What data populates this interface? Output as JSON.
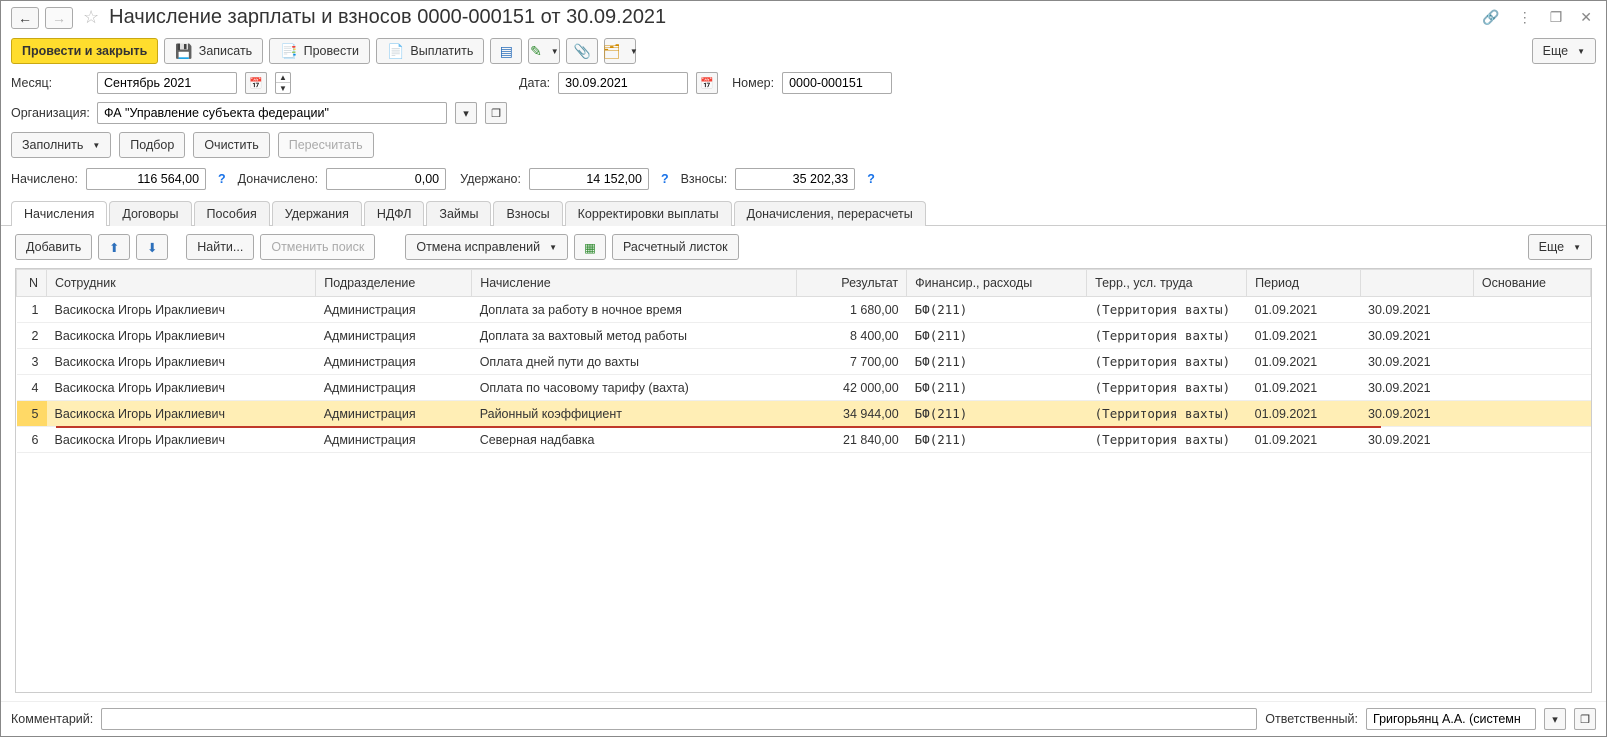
{
  "title": "Начисление зарплаты и взносов 0000-000151 от 30.09.2021",
  "toolbar": {
    "post_and_close": "Провести и закрыть",
    "save": "Записать",
    "post": "Провести",
    "pay": "Выплатить",
    "more": "Еще"
  },
  "fields": {
    "month_label": "Месяц:",
    "month_value": "Сентябрь 2021",
    "date_label": "Дата:",
    "date_value": "30.09.2021",
    "number_label": "Номер:",
    "number_value": "0000-000151",
    "org_label": "Организация:",
    "org_value": "ФА \"Управление субъекта федерации\""
  },
  "row_actions": {
    "fill": "Заполнить",
    "select": "Подбор",
    "clear": "Очистить",
    "recalc": "Пересчитать"
  },
  "totals": {
    "accrued_label": "Начислено:",
    "accrued_value": "116 564,00",
    "add_accrued_label": "Доначислено:",
    "add_accrued_value": "0,00",
    "withheld_label": "Удержано:",
    "withheld_value": "14 152,00",
    "contrib_label": "Взносы:",
    "contrib_value": "35 202,33"
  },
  "tabs": [
    "Начисления",
    "Договоры",
    "Пособия",
    "Удержания",
    "НДФЛ",
    "Займы",
    "Взносы",
    "Корректировки выплаты",
    "Доначисления, перерасчеты"
  ],
  "active_tab_index": 0,
  "sub_toolbar": {
    "add": "Добавить",
    "find": "Найти...",
    "cancel_search": "Отменить поиск",
    "cancel_corrections": "Отмена исправлений",
    "payslip": "Расчетный листок",
    "more": "Еще"
  },
  "table": {
    "headers": [
      "N",
      "Сотрудник",
      "Подразделение",
      "Начисление",
      "Результат",
      "Финансир., расходы",
      "Терр., усл. труда",
      "Период",
      "",
      "Основание"
    ],
    "rows": [
      {
        "n": "1",
        "employee": "Васикоска Игорь Ираклиевич",
        "dept": "Администрация",
        "accrual": "Доплата за работу в ночное время",
        "result": "1 680,00",
        "fin": "БФ(211)",
        "terr": "(Территория вахты)",
        "p1": "01.09.2021",
        "p2": "30.09.2021",
        "basis": ""
      },
      {
        "n": "2",
        "employee": "Васикоска Игорь Ираклиевич",
        "dept": "Администрация",
        "accrual": "Доплата за вахтовый метод работы",
        "result": "8 400,00",
        "fin": "БФ(211)",
        "terr": "(Территория вахты)",
        "p1": "01.09.2021",
        "p2": "30.09.2021",
        "basis": ""
      },
      {
        "n": "3",
        "employee": "Васикоска Игорь Ираклиевич",
        "dept": "Администрация",
        "accrual": "Оплата дней пути до вахты",
        "result": "7 700,00",
        "fin": "БФ(211)",
        "terr": "(Территория вахты)",
        "p1": "01.09.2021",
        "p2": "30.09.2021",
        "basis": ""
      },
      {
        "n": "4",
        "employee": "Васикоска Игорь Ираклиевич",
        "dept": "Администрация",
        "accrual": "Оплата по часовому тарифу (вахта)",
        "result": "42 000,00",
        "fin": "БФ(211)",
        "terr": "(Территория вахты)",
        "p1": "01.09.2021",
        "p2": "30.09.2021",
        "basis": ""
      },
      {
        "n": "5",
        "employee": "Васикоска Игорь Ираклиевич",
        "dept": "Администрация",
        "accrual": "Районный коэффициент",
        "result": "34 944,00",
        "fin": "БФ(211)",
        "terr": "(Территория вахты)",
        "p1": "01.09.2021",
        "p2": "30.09.2021",
        "basis": ""
      },
      {
        "n": "6",
        "employee": "Васикоска Игорь Ираклиевич",
        "dept": "Администрация",
        "accrual": "Северная надбавка",
        "result": "21 840,00",
        "fin": "БФ(211)",
        "terr": "(Территория вахты)",
        "p1": "01.09.2021",
        "p2": "30.09.2021",
        "basis": ""
      }
    ],
    "selected_index": 4
  },
  "footer": {
    "comment_label": "Комментарий:",
    "comment_value": "",
    "responsible_label": "Ответственный:",
    "responsible_value": "Григорьянц А.А. (системн"
  }
}
